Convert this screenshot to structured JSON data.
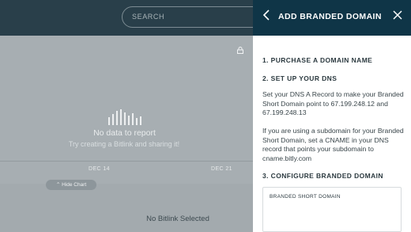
{
  "search": {
    "placeholder": "SEARCH"
  },
  "chart": {
    "empty_title": "No data to report",
    "empty_hint": "Try creating a Bitlink and sharing it!",
    "dates": [
      "DEC 14",
      "DEC 21"
    ],
    "hide_chart_label": "Hide Chart"
  },
  "lower": {
    "empty_label": "No Bitlink Selected"
  },
  "panel": {
    "title": "ADD BRANDED DOMAIN",
    "step1": "1. PURCHASE A DOMAIN NAME",
    "step2": "2. SET UP YOUR DNS",
    "dns_text": "Set your DNS A Record to make your Branded Short Domain point to 67.199.248.12 and 67.199.248.13",
    "subdomain_text": "If you are using a subdomain for your Branded Short Domain, set a CNAME in your DNS record that points your subdomain to cname.bitly.com",
    "step3": "3. CONFIGURE BRANDED DOMAIN",
    "input_label": "BRANDED SHORT DOMAIN"
  },
  "colors": {
    "header": "#0f3547",
    "overlay_bar": "#293f4a"
  }
}
